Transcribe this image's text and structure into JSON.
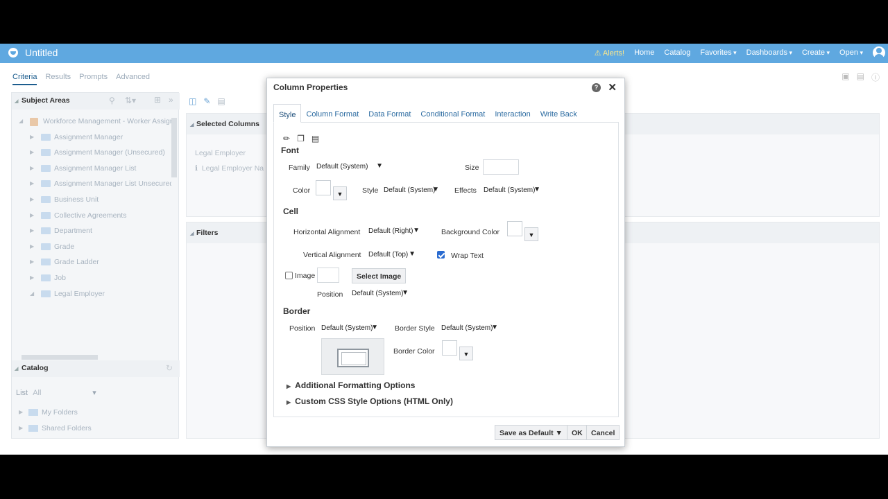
{
  "app": {
    "title": "Untitled",
    "nav": {
      "alerts": "Alerts!",
      "home": "Home",
      "catalog": "Catalog",
      "favorites": "Favorites",
      "dashboards": "Dashboards",
      "create": "Create",
      "open": "Open"
    }
  },
  "editor_tabs": [
    "Criteria",
    "Results",
    "Prompts",
    "Advanced"
  ],
  "subject_areas": {
    "title": "Subject Areas",
    "root": "Workforce Management - Worker Assignm",
    "items": [
      "Assignment Manager",
      "Assignment Manager (Unsecured)",
      "Assignment Manager List",
      "Assignment Manager List Unsecured",
      "Business Unit",
      "Collective Agreements",
      "Department",
      "Grade",
      "Grade Ladder",
      "Job",
      "Legal Employer"
    ]
  },
  "catalog": {
    "title": "Catalog",
    "list_label": "List",
    "list_value": "All",
    "folders": [
      "My Folders",
      "Shared Folders"
    ]
  },
  "selected_columns": {
    "title": "Selected Columns",
    "group": "Legal Employer",
    "column": "Legal Employer Na"
  },
  "filters": {
    "title": "Filters"
  },
  "dialog": {
    "title": "Column Properties",
    "tabs": [
      "Style",
      "Column Format",
      "Data Format",
      "Conditional Format",
      "Interaction",
      "Write Back"
    ],
    "font": {
      "section": "Font",
      "family_label": "Family",
      "family_value": "Default (System)",
      "size_label": "Size",
      "size_value": "",
      "color_label": "Color",
      "style_label": "Style",
      "style_value": "Default (System)",
      "effects_label": "Effects",
      "effects_value": "Default (System)"
    },
    "cell": {
      "section": "Cell",
      "halign_label": "Horizontal Alignment",
      "halign_value": "Default (Right)",
      "bgcolor_label": "Background Color",
      "valign_label": "Vertical Alignment",
      "valign_value": "Default (Top)",
      "wrap_label": "Wrap Text",
      "wrap_checked": true,
      "image_label": "Image",
      "image_checked": false,
      "select_image": "Select Image",
      "position_label": "Position",
      "position_value": "Default (System)"
    },
    "border": {
      "section": "Border",
      "position_label": "Position",
      "position_value": "Default (System)",
      "style_label": "Border Style",
      "style_value": "Default (System)",
      "color_label": "Border Color"
    },
    "additional": "Additional Formatting Options",
    "custom_css": "Custom CSS Style Options (HTML Only)",
    "buttons": {
      "save_default": "Save as Default",
      "ok": "OK",
      "cancel": "Cancel"
    }
  }
}
